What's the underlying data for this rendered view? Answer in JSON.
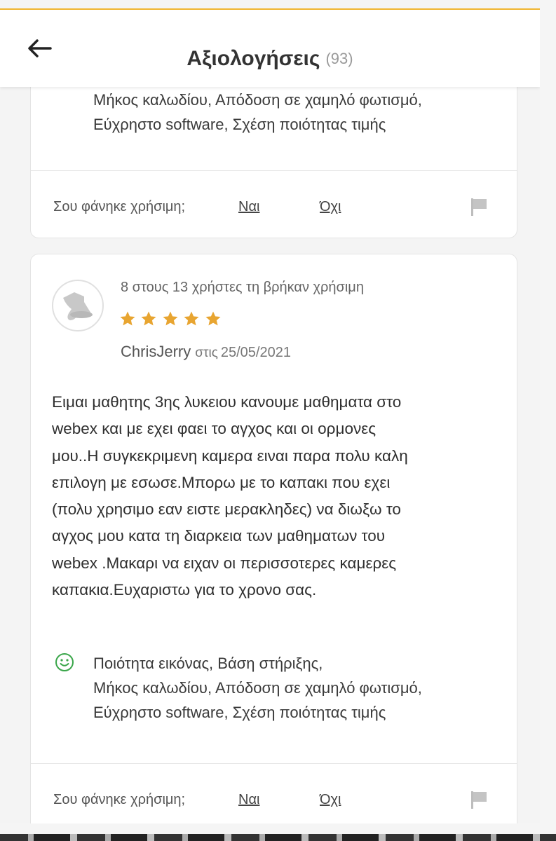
{
  "header": {
    "title": "Αξιολογήσεις",
    "count": "93",
    "back_icon": "arrow-left-icon"
  },
  "reviews": [
    {
      "attributes_lines": [
        "Μήκος καλωδίου, Απόδοση σε χαμηλό φωτισμό,",
        "Εύχρηστο software, Σχέση ποιότητας τιμής"
      ],
      "helpful_question": "Σου φάνηκε χρήσιμη;",
      "yes_label": "Ναι",
      "no_label": "Όχι"
    },
    {
      "helpful_count": "8 στους 13 χρήστες τη βρήκαν χρήσιμη",
      "rating": 5,
      "rating_max": 5,
      "author": "ChrisJerry",
      "date_prefix": "στις",
      "date": "25/05/2021",
      "body_lines": [
        "Ειμαι μαθητης 3ης λυκειου κανουμε μαθηματα στο",
        "webex και με εχει φαει το αγχος και οι ορμονες",
        "μου..Η συγκεκριμενη καμερα ειναι παρα πολυ καλη",
        "επιλογη με εσωσε.Μπορω με το καπακι που εχει",
        "(πολυ χρησιμο εαν ειστε μερακληδες) να διωξω το",
        "αγχος μου κατα τη διαρκεια των μαθηματων του",
        "webex .Μακαρι να ειχαν οι περισσοτερες καμερες",
        "καπακια.Ευχαριστω για το χρονο σας."
      ],
      "attributes_lines": [
        "Ποιότητα εικόνας, Βάση στήριξης,",
        "Μήκος καλωδίου, Απόδοση σε χαμηλό φωτισμό,",
        "Εύχρηστο software, Σχέση ποιότητας τιμής"
      ],
      "helpful_question": "Σου φάνηκε χρήσιμη;",
      "yes_label": "Ναι",
      "no_label": "Όχι"
    }
  ],
  "colors": {
    "accent": "#f0b530",
    "star": "#e8a531",
    "smiley": "#3aa64a",
    "flag": "#bdbdbd"
  },
  "icons": {
    "avatar": "top-hat-avatar-icon",
    "star": "star-icon",
    "positive": "smiley-icon",
    "report": "flag-icon"
  }
}
